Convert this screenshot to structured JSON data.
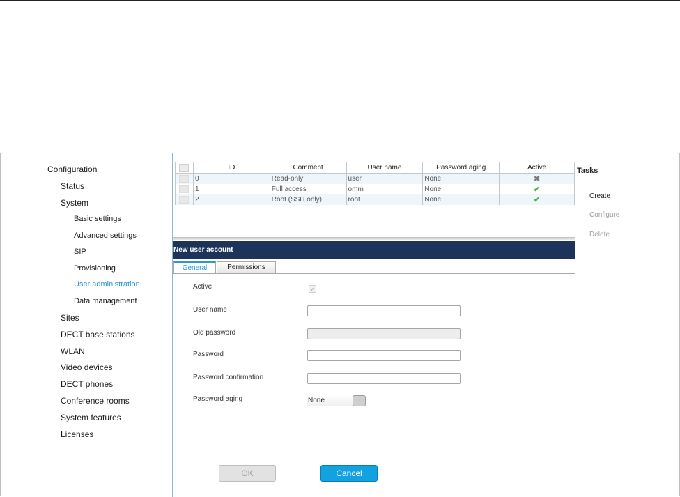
{
  "nav": {
    "items": [
      {
        "label": "Configuration"
      },
      {
        "label": "Status"
      },
      {
        "label": "System"
      },
      {
        "label": "Basic settings"
      },
      {
        "label": "Advanced settings"
      },
      {
        "label": "SIP"
      },
      {
        "label": "Provisioning"
      },
      {
        "label": "User administration"
      },
      {
        "label": "Data management"
      },
      {
        "label": "Sites"
      },
      {
        "label": "DECT base stations"
      },
      {
        "label": "WLAN"
      },
      {
        "label": "Video devices"
      },
      {
        "label": "DECT phones"
      },
      {
        "label": "Conference rooms"
      },
      {
        "label": "System features"
      },
      {
        "label": "Licenses"
      }
    ],
    "active_item": "User administration",
    "accent_color": "#2c9ad1"
  },
  "users_table": {
    "columns": [
      "ID",
      "Comment",
      "User name",
      "Password aging",
      "Active"
    ],
    "rows": [
      {
        "id": "0",
        "comment": "Read-only",
        "user_name": "user",
        "password_aging": "None",
        "active": "inactive-x-icon"
      },
      {
        "id": "1",
        "comment": "Full access",
        "user_name": "omm",
        "password_aging": "None",
        "active": "check-icon"
      },
      {
        "id": "2",
        "comment": "Root (SSH only)",
        "user_name": "root",
        "password_aging": "None",
        "active": "check-icon"
      }
    ]
  },
  "form": {
    "title": "New user account",
    "header_color": "#1c3459",
    "tabs": [
      {
        "label": "General",
        "selected": true
      },
      {
        "label": "Permissions",
        "selected": false
      }
    ],
    "fields": {
      "active": {
        "label": "Active",
        "checked": true,
        "disabled": true
      },
      "user_name": {
        "label": "User name",
        "value": ""
      },
      "old_password": {
        "label": "Old password",
        "value": "",
        "disabled": true
      },
      "password": {
        "label": "Password",
        "value": ""
      },
      "password_confirmation": {
        "label": "Password confirmation",
        "value": ""
      },
      "password_aging": {
        "label": "Password aging",
        "value": "None"
      }
    },
    "buttons": {
      "ok": "OK",
      "cancel": "Cancel"
    }
  },
  "tasks": {
    "title": "Tasks",
    "items": [
      {
        "label": "Create",
        "enabled": true
      },
      {
        "label": "Configure",
        "enabled": false
      },
      {
        "label": "Delete",
        "enabled": false
      }
    ]
  }
}
